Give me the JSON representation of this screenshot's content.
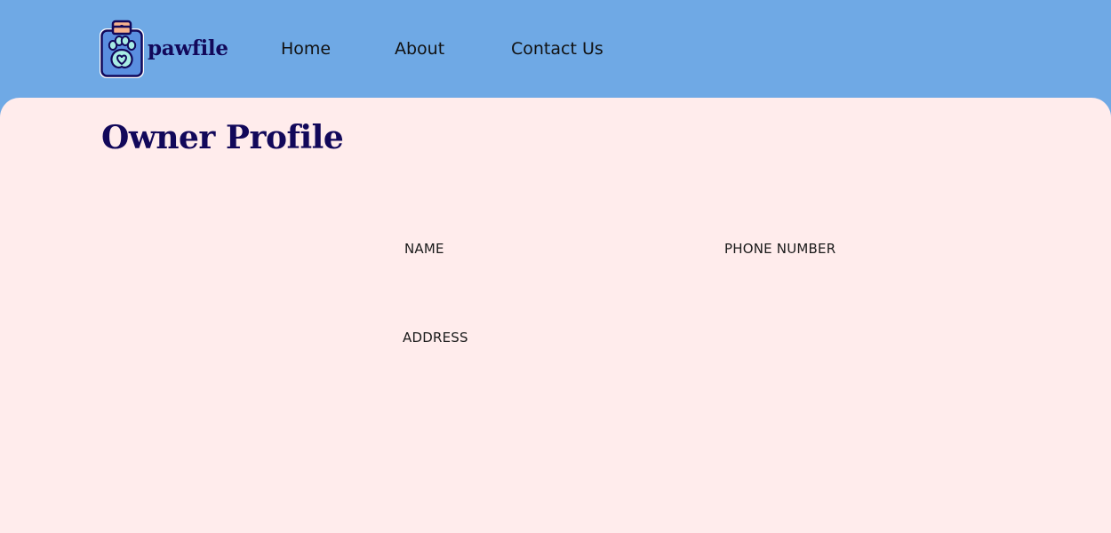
{
  "brand": {
    "name": "pawfile",
    "colors": {
      "header_bg": "#6fa9e5",
      "content_bg": "#ffecec",
      "brand_navy": "#12085a",
      "logo_fill": "#5a8fe0",
      "paw_fill": "#a7ece4",
      "clip_fill": "#f6b28e"
    },
    "logo_icon": "clipboard-paw-icon"
  },
  "nav": {
    "items": [
      {
        "label": "Home"
      },
      {
        "label": "About"
      },
      {
        "label": "Contact Us"
      }
    ]
  },
  "profile": {
    "title": "Owner Profile",
    "fields": {
      "name_label": "NAME",
      "phone_label": "PHONE NUMBER",
      "address_label": "ADDRESS"
    }
  }
}
